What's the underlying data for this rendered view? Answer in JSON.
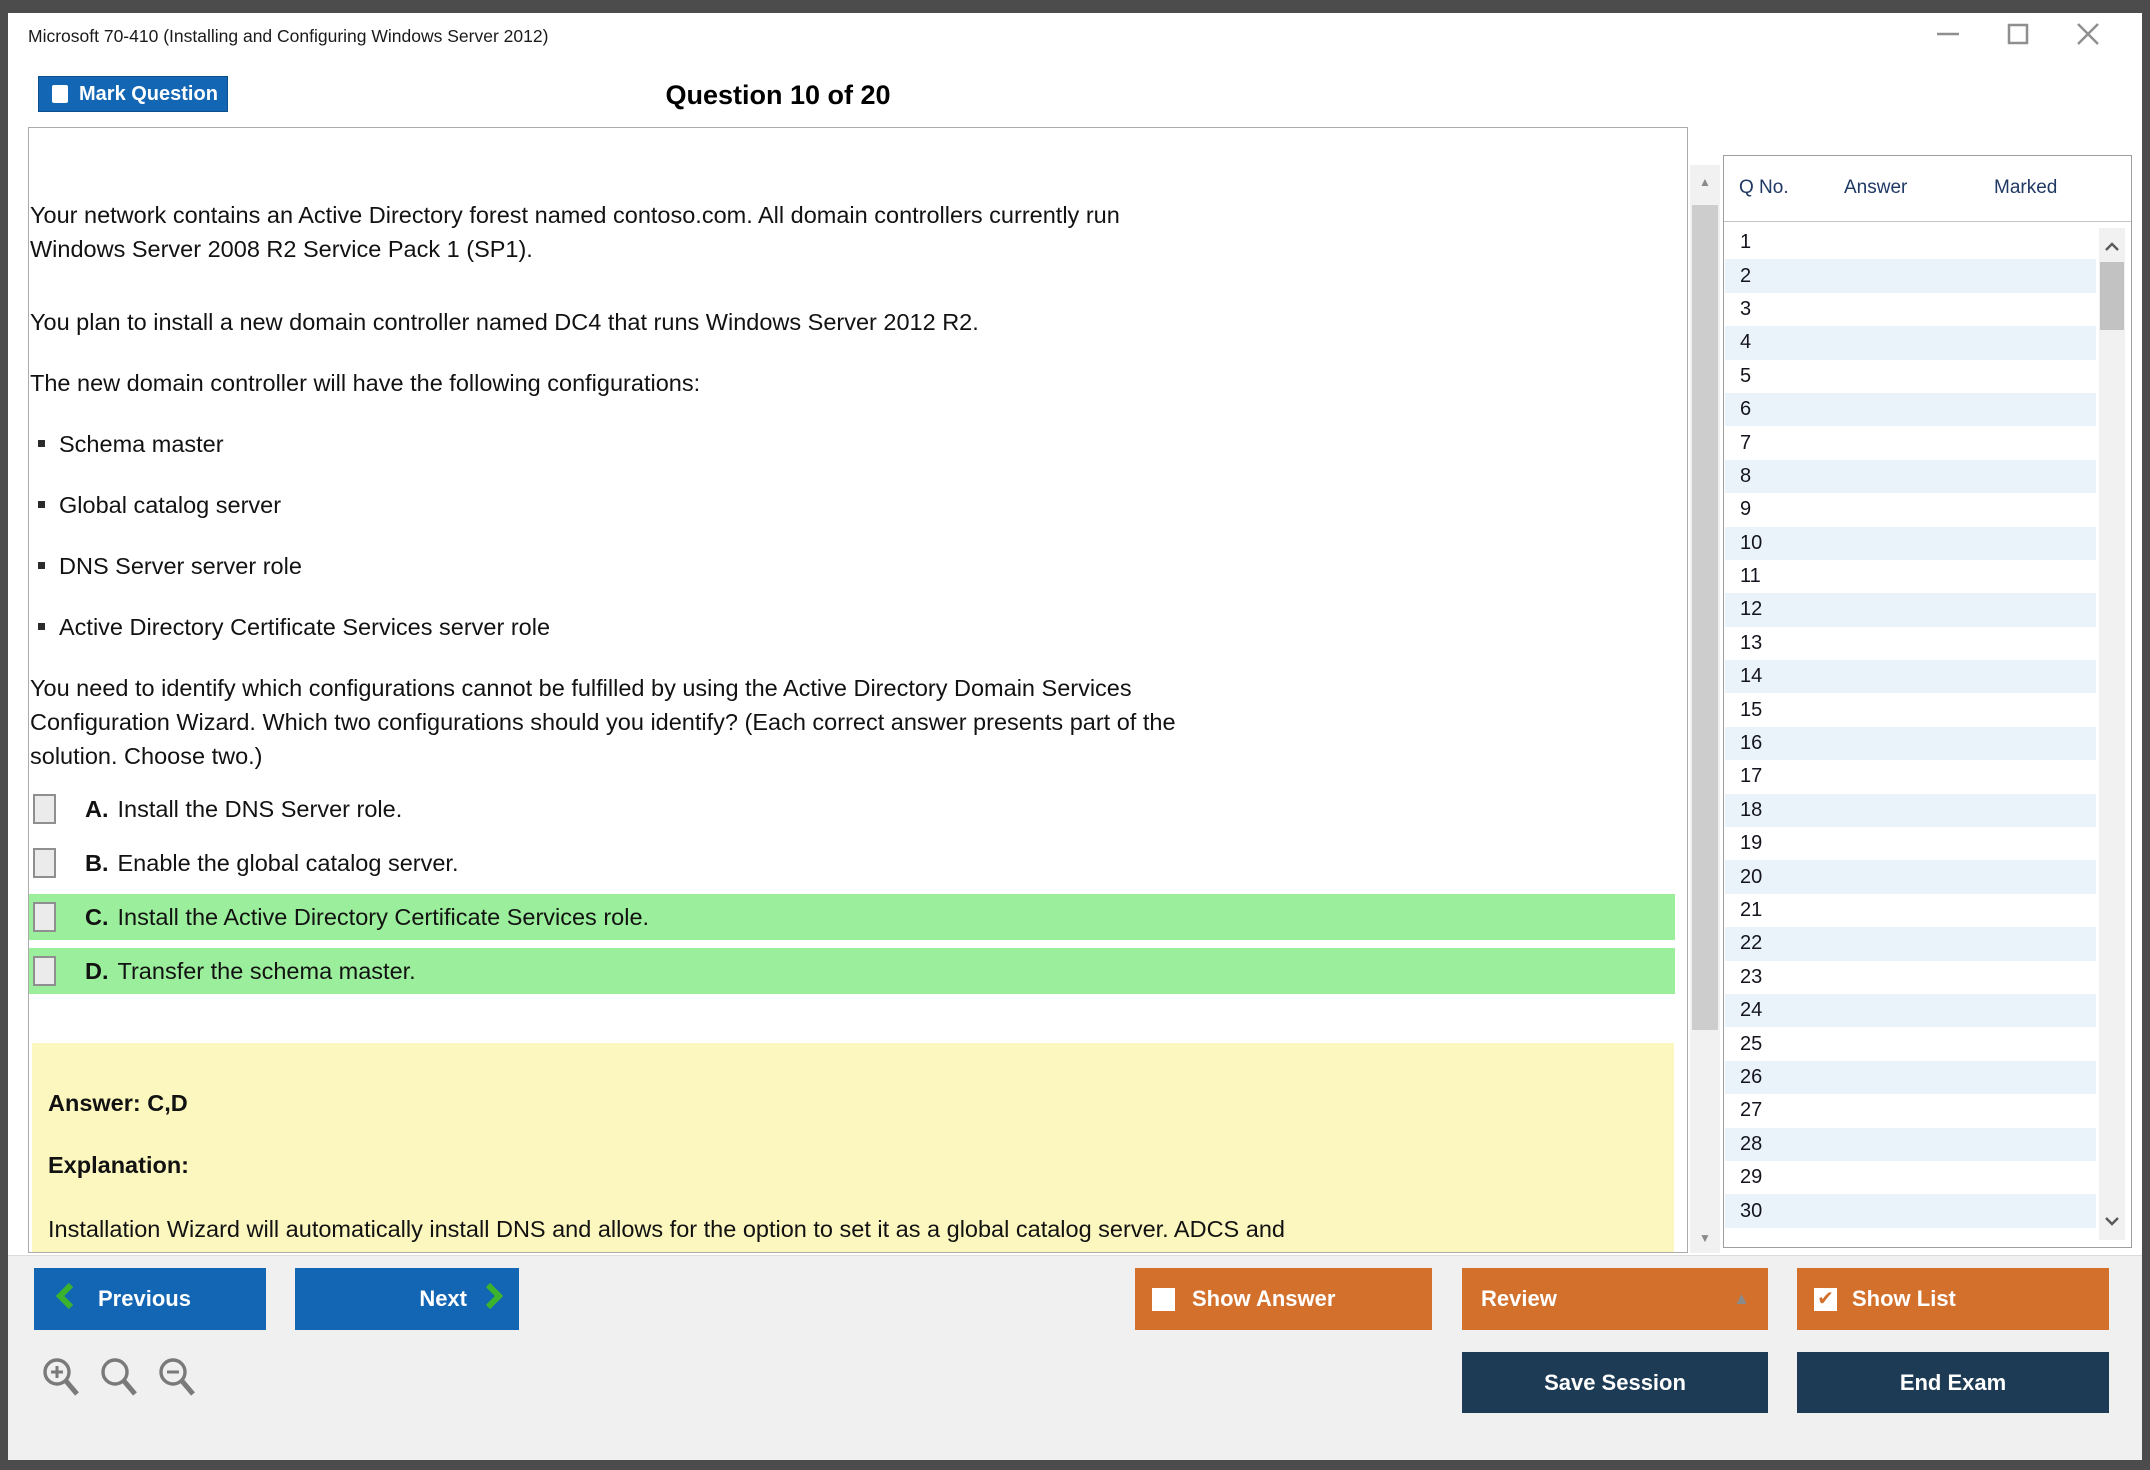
{
  "window": {
    "title": "Microsoft 70-410 (Installing and Configuring Windows Server 2012)"
  },
  "header": {
    "mark_button_label": "Mark Question",
    "question_counter": "Question 10 of 20"
  },
  "question": {
    "paragraphs": [
      "Your network contains an Active Directory forest named contoso.com. All domain controllers currently run Windows Server 2008 R2 Service Pack 1 (SP1).",
      "You plan to install a new domain controller named DC4 that runs Windows Server 2012 R2.",
      "The new domain controller will have the following configurations:"
    ],
    "bullets": [
      "Schema master",
      "Global catalog server",
      "DNS Server server role",
      "Active Directory Certificate Services server role"
    ],
    "prompt": "You need to identify which configurations cannot be fulfilled by using the Active Directory Domain Services Configuration Wizard. Which two configurations should you identify? (Each correct answer presents part of the solution. Choose two.)",
    "options": [
      {
        "letter": "A.",
        "text": "Install the DNS Server role.",
        "highlighted": false
      },
      {
        "letter": "B.",
        "text": "Enable the global catalog server.",
        "highlighted": false
      },
      {
        "letter": "C.",
        "text": "Install the Active Directory Certificate Services role.",
        "highlighted": true
      },
      {
        "letter": "D.",
        "text": "Transfer the schema master.",
        "highlighted": true
      }
    ]
  },
  "answer_box": {
    "answer": "Answer: C,D",
    "explanation_heading": "Explanation:",
    "explanation": "Installation Wizard will automatically install DNS and allows for the option to set it as a global catalog server. ADCS and"
  },
  "sidebar": {
    "columns": [
      "Q No.",
      "Answer",
      "Marked"
    ],
    "row_numbers": [
      1,
      2,
      3,
      4,
      5,
      6,
      7,
      8,
      9,
      10,
      11,
      12,
      13,
      14,
      15,
      16,
      17,
      18,
      19,
      20,
      21,
      22,
      23,
      24,
      25,
      26,
      27,
      28,
      29,
      30
    ]
  },
  "footer": {
    "previous": "Previous",
    "next": "Next",
    "show_answer": "Show Answer",
    "review": "Review",
    "show_list": "Show List",
    "save_session": "Save Session",
    "end_exam": "End Exam"
  },
  "colors": {
    "accent_blue": "#1366b4",
    "accent_orange": "#d2702c",
    "navy": "#1d3b55",
    "chevron_green": "#3cb32d",
    "highlight_green": "#9bee9b",
    "answer_yellow": "#fcf7be",
    "stripe_blue": "#ebf3fa"
  }
}
